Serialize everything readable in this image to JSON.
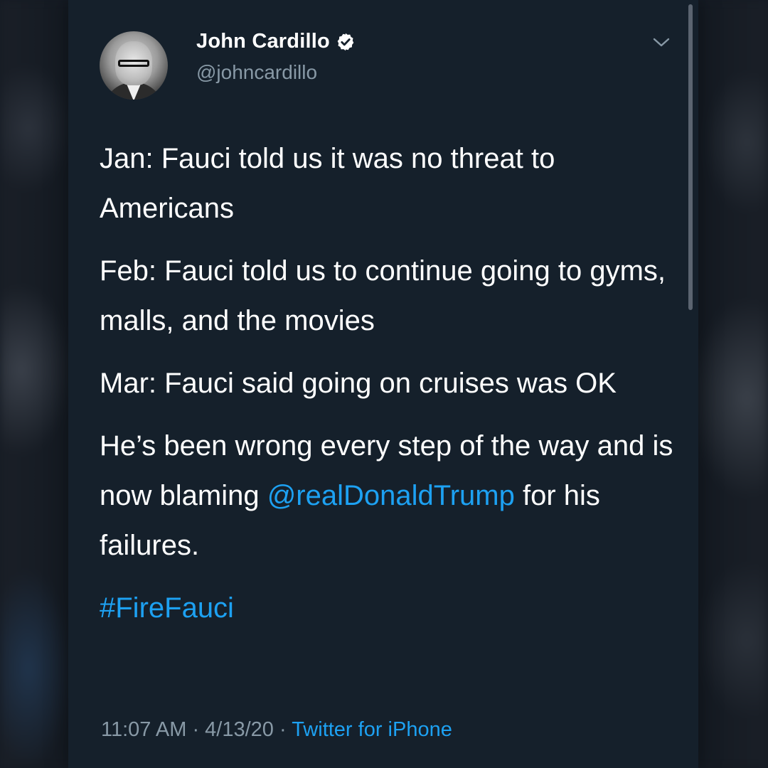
{
  "tweet": {
    "author": {
      "display_name": "John Cardillo",
      "handle": "@johncardillo",
      "verified_icon": "verified-badge-icon"
    },
    "menu_icon": "chevron-down-icon",
    "paragraphs": [
      "Jan: Fauci told us it was no threat to Americans",
      "Feb: Fauci told us to continue going to gyms, malls, and the movies",
      "Mar: Fauci said going on cruises was OK"
    ],
    "last_paragraph": {
      "before_mention": "He’s been wrong every step of the way and is now blaming ",
      "mention": "@realDonaldTrump",
      "after_mention": " for his failures."
    },
    "hashtag": "#FireFauci",
    "meta": {
      "time": "11:07 AM",
      "separator": " · ",
      "date": "4/13/20",
      "source": "Twitter for iPhone"
    }
  },
  "colors": {
    "background": "#15202b",
    "text": "#ffffff",
    "secondary_text": "#8899a6",
    "link": "#1da1f2"
  }
}
